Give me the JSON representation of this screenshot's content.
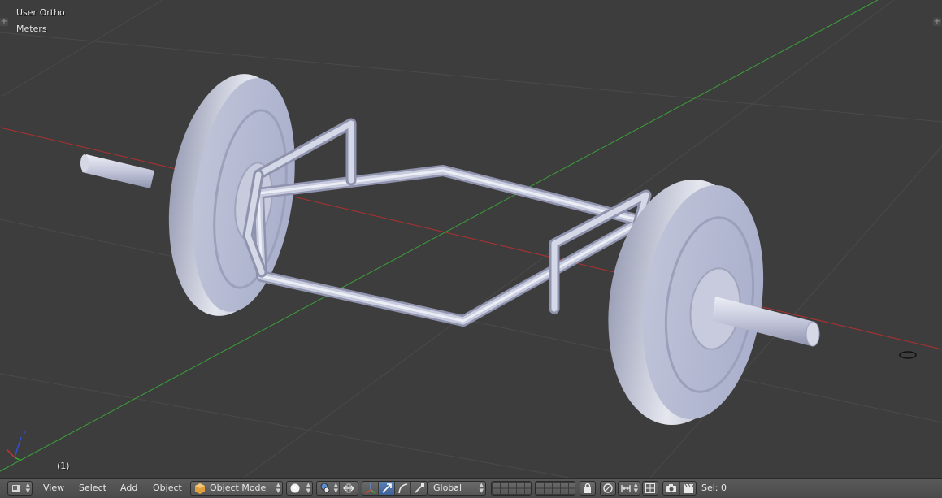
{
  "viewport": {
    "view_name": "User Ortho",
    "units": "Meters",
    "frame": "(1)"
  },
  "header": {
    "menu": [
      "View",
      "Select",
      "Add",
      "Object"
    ],
    "mode": "Object Mode",
    "orientation": "Global",
    "selection": "Sel: 0"
  },
  "icons": {
    "editor_type": "3d-view-icon",
    "mode": "cube-icon",
    "shading": "sphere-icon",
    "pivot": "pivot-icon",
    "manipulator": "manipulator-icon"
  },
  "colors": {
    "x_axis": "#b03030",
    "y_axis": "#3aa03a",
    "metal_light": "#e8eaf2",
    "metal_mid": "#b4b8d0",
    "metal_dark": "#8a8ea8",
    "active_button": "#5b80b4"
  }
}
